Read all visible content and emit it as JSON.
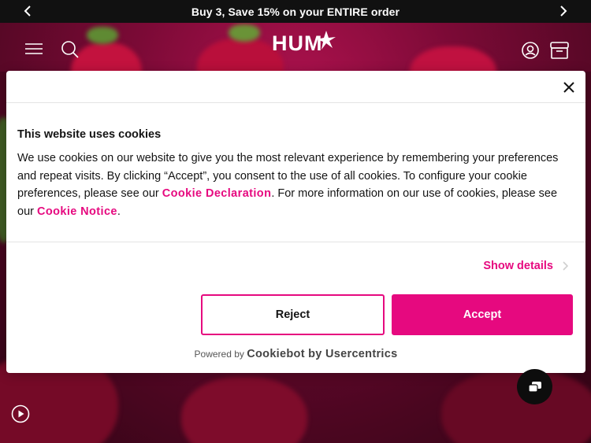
{
  "promo": {
    "text": "Buy 3, Save 15% on your ENTIRE order",
    "prev_icon": "chevron-left-icon",
    "next_icon": "chevron-right-icon"
  },
  "header": {
    "logo": "HUM",
    "icons": [
      "menu-icon",
      "search-icon",
      "account-icon",
      "cart-icon"
    ]
  },
  "cookie_dialog": {
    "title": "This website uses cookies",
    "body_part1": "We use cookies on our website to give you the most relevant experience by remembering your preferences and repeat visits. By clicking “Accept”, you consent to the use of all cookies. To configure your cookie preferences, please see our ",
    "declaration_link": "Cookie Declaration",
    "body_part2": ". For more information on our use of cookies, please see our ",
    "notice_link": "Cookie Notice",
    "body_part3": ".",
    "show_details": "Show details",
    "reject_label": "Reject",
    "accept_label": "Accept",
    "powered_prefix": "Powered by",
    "powered_brand": "Cookiebot by Usercentrics"
  },
  "colors": {
    "accent": "#e6097f",
    "promo_bg": "#111111",
    "hero": "#8a0c3c"
  }
}
